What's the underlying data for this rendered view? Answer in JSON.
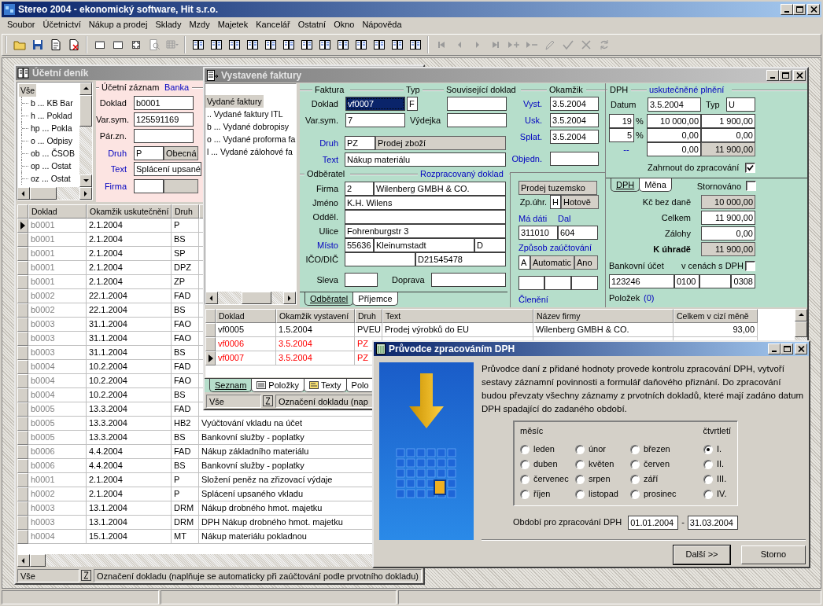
{
  "app": {
    "title": "Stereo 2004 - ekonomický software, Hit s.r.o."
  },
  "menu": [
    "Soubor",
    "Účetnictví",
    "Nákup a prodej",
    "Sklady",
    "Mzdy",
    "Majetek",
    "Kancelář",
    "Ostatní",
    "Okno",
    "Nápověda"
  ],
  "toolbar": [
    [
      {
        "kind": "folder",
        "disabled": false
      },
      {
        "kind": "save",
        "disabled": false
      },
      {
        "kind": "properties",
        "disabled": false
      },
      {
        "kind": "export",
        "disabled": false
      }
    ],
    [
      {
        "kind": "window",
        "disabled": false
      },
      {
        "kind": "window",
        "disabled": false
      },
      {
        "kind": "fit",
        "disabled": false
      },
      {
        "kind": "preview",
        "disabled": true
      },
      {
        "kind": "grid",
        "disabled": true
      }
    ],
    [
      {
        "kind": "book",
        "disabled": false
      },
      {
        "kind": "book",
        "disabled": false
      },
      {
        "kind": "book",
        "disabled": false
      },
      {
        "kind": "book",
        "disabled": false
      },
      {
        "kind": "book",
        "disabled": false
      },
      {
        "kind": "book",
        "disabled": false
      },
      {
        "kind": "book",
        "disabled": false
      },
      {
        "kind": "book",
        "disabled": false
      },
      {
        "kind": "book",
        "disabled": false
      },
      {
        "kind": "book",
        "disabled": false
      },
      {
        "kind": "book",
        "disabled": false
      },
      {
        "kind": "book",
        "disabled": false
      },
      {
        "kind": "book",
        "disabled": false
      }
    ],
    [
      {
        "kind": "first",
        "disabled": true
      },
      {
        "kind": "prev",
        "disabled": true
      },
      {
        "kind": "next",
        "disabled": true
      },
      {
        "kind": "last",
        "disabled": true
      },
      {
        "kind": "add",
        "disabled": true
      },
      {
        "kind": "remove",
        "disabled": true
      },
      {
        "kind": "pencil",
        "disabled": true
      },
      {
        "kind": "check",
        "disabled": true
      },
      {
        "kind": "cross",
        "disabled": true
      },
      {
        "kind": "refresh",
        "disabled": true
      }
    ]
  ],
  "journal": {
    "title": "Účetní deník",
    "tree": [
      {
        "label": "Vše",
        "selected": true,
        "children": [
          {
            "label": "b ... KB Bar",
            "selected": false
          },
          {
            "label": "h ... Poklad",
            "selected": false
          },
          {
            "label": "hp ... Pokla",
            "selected": false
          },
          {
            "label": "o ... Odpisy",
            "selected": false
          },
          {
            "label": "ob ... ČSOB",
            "selected": false
          },
          {
            "label": "op ... Ostat",
            "selected": false
          },
          {
            "label": "oz ... Ostat",
            "selected": false
          }
        ]
      }
    ],
    "record": {
      "legends": [
        {
          "text": "Účetní záznam",
          "link": false
        },
        {
          "text": "Banka",
          "link": true
        }
      ],
      "rows": [
        {
          "items": [
            {
              "kind": "label",
              "text": "Doklad",
              "link": false
            },
            {
              "kind": "box",
              "value": "b0001",
              "readonly": false
            }
          ]
        },
        {
          "items": [
            {
              "kind": "label",
              "text": "Var.sym.",
              "link": false
            },
            {
              "kind": "box",
              "value": "125591169",
              "readonly": false
            }
          ]
        },
        {
          "items": [
            {
              "kind": "label",
              "text": "Pár.zn.",
              "link": false
            },
            {
              "kind": "box",
              "readonly": false
            }
          ]
        },
        {
          "items": [
            {
              "kind": "label",
              "text": "Druh",
              "link": true
            },
            {
              "kind": "box",
              "value": "P",
              "readonly": false
            },
            {
              "kind": "box",
              "value": "Obecná",
              "readonly": true
            }
          ]
        },
        {
          "items": [
            {
              "kind": "label",
              "text": "Text",
              "link": true
            },
            {
              "kind": "box",
              "value": "Splácení upsané",
              "readonly": false
            }
          ]
        },
        {
          "items": [
            {
              "kind": "label",
              "text": "Firma",
              "link": true
            },
            {
              "kind": "box",
              "readonly": false
            },
            {
              "kind": "box",
              "readonly": true
            }
          ]
        }
      ]
    },
    "columns": [
      "Doklad",
      "Okamžik uskutečnění",
      "Druh"
    ],
    "rows": [
      {
        "doklad": "b0001",
        "date": "2.1.2004",
        "druh": "P",
        "selected": true
      },
      {
        "doklad": "b0001",
        "date": "2.1.2004",
        "druh": "BS",
        "selected": false
      },
      {
        "doklad": "b0001",
        "date": "2.1.2004",
        "druh": "SP",
        "selected": false
      },
      {
        "doklad": "b0001",
        "date": "2.1.2004",
        "druh": "DPZ",
        "selected": false
      },
      {
        "doklad": "b0001",
        "date": "2.1.2004",
        "druh": "ZP",
        "selected": false
      },
      {
        "doklad": "b0002",
        "date": "22.1.2004",
        "druh": "FAD",
        "selected": false
      },
      {
        "doklad": "b0002",
        "date": "22.1.2004",
        "druh": "BS",
        "selected": false
      },
      {
        "doklad": "b0003",
        "date": "31.1.2004",
        "druh": "FAO",
        "selected": false
      },
      {
        "doklad": "b0003",
        "date": "31.1.2004",
        "druh": "FAO",
        "selected": false
      },
      {
        "doklad": "b0003",
        "date": "31.1.2004",
        "druh": "BS",
        "selected": false
      },
      {
        "doklad": "b0004",
        "date": "10.2.2004",
        "druh": "FAD",
        "selected": false
      },
      {
        "doklad": "b0004",
        "date": "10.2.2004",
        "druh": "FAO",
        "selected": false
      },
      {
        "doklad": "b0004",
        "date": "10.2.2004",
        "druh": "BS",
        "selected": false
      },
      {
        "doklad": "b0005",
        "date": "13.3.2004",
        "druh": "FAD",
        "selected": false
      },
      {
        "doklad": "b0005",
        "date": "13.3.2004",
        "druh": "HB2",
        "text": "Vyúčtování vkladu na účet",
        "selected": false
      },
      {
        "doklad": "b0005",
        "date": "13.3.2004",
        "druh": "BS",
        "text": "Bankovní služby - poplatky",
        "selected": false
      },
      {
        "doklad": "b0006",
        "date": "4.4.2004",
        "druh": "FAD",
        "text": "Nákup základního materiálu",
        "selected": false
      },
      {
        "doklad": "b0006",
        "date": "4.4.2004",
        "druh": "BS",
        "text": "Bankovní služby - poplatky",
        "selected": false
      },
      {
        "doklad": "h0001",
        "date": "2.1.2004",
        "druh": "P",
        "text": "Složení peněz na zřizovací výdaje",
        "selected": false
      },
      {
        "doklad": "h0002",
        "date": "2.1.2004",
        "druh": "P",
        "text": "Splácení upsaného vkladu",
        "selected": false
      },
      {
        "doklad": "h0003",
        "date": "13.1.2004",
        "druh": "DRM",
        "text": "Nákup drobného hmot. majetku",
        "selected": false
      },
      {
        "doklad": "h0003",
        "date": "13.1.2004",
        "druh": "DRM",
        "text": "DPH Nákup drobného hmot. majetku",
        "selected": false
      },
      {
        "doklad": "h0004",
        "date": "15.1.2004",
        "druh": "MT",
        "text": "Nákup materiálu pokladnou",
        "selected": false
      }
    ],
    "status": {
      "filter": "Vše",
      "hint": "Označení dokladu (naplňuje se automaticky při zaúčtování podle prvotního dokladu)"
    }
  },
  "invoices": {
    "title": "Vystavené faktury",
    "tree": [
      {
        "label": "Vydané faktury",
        "selected": true
      },
      {
        "label": ".. Vydané faktury ITL",
        "selected": false
      },
      {
        "label": "b ... Vydané dobropisy",
        "selected": false
      },
      {
        "label": "o ... Vydané proforma fa",
        "selected": false
      },
      {
        "label": "l ... Vydané zálohové fa",
        "selected": false
      }
    ],
    "form": {
      "head_legends": [
        {
          "text": "Faktura",
          "link": false
        },
        {
          "text": "Typ",
          "link": false
        },
        {
          "text": "Související doklad",
          "link": false
        },
        {
          "text": "Okamžik",
          "link": false
        }
      ],
      "invoice_rows": [
        {
          "items": [
            {
              "kind": "label",
              "text": "Doklad",
              "link": false
            },
            {
              "kind": "box",
              "value": "vf0007",
              "readonly": false,
              "highlighted": true
            },
            {
              "kind": "box",
              "value": "F",
              "readonly": false,
              "highlighted": false
            },
            {
              "kind": "box",
              "readonly": false,
              "highlighted": false
            }
          ]
        },
        {
          "items": [
            {
              "kind": "label",
              "text": "Var.sym.",
              "link": false
            },
            {
              "kind": "box",
              "value": "7",
              "readonly": false,
              "highlighted": false
            },
            {
              "kind": "label",
              "text": "Výdejka",
              "link": false
            },
            {
              "kind": "box",
              "readonly": false,
              "highlighted": false
            }
          ]
        },
        {
          "items": [
            {
              "kind": "label",
              "text": "Druh",
              "link": true
            },
            {
              "kind": "box",
              "value": "PZ",
              "readonly": false,
              "highlighted": false
            },
            {
              "kind": "box",
              "value": "Prodej zboží",
              "readonly": true,
              "highlighted": false
            }
          ]
        },
        {
          "items": [
            {
              "kind": "label",
              "text": "Text",
              "link": true
            },
            {
              "kind": "box",
              "value": "Nákup materiálu",
              "readonly": false,
              "highlighted": false
            }
          ]
        }
      ],
      "date_rows": [
        {
          "items": [
            {
              "kind": "label",
              "text": "Vyst.",
              "link": true
            },
            {
              "kind": "box",
              "value": "3.5.2004",
              "readonly": false
            }
          ]
        },
        {
          "items": [
            {
              "kind": "label",
              "text": "Usk.",
              "link": true
            },
            {
              "kind": "box",
              "value": "3.5.2004",
              "readonly": false
            }
          ]
        },
        {
          "items": [
            {
              "kind": "label",
              "text": "Splat.",
              "link": true
            },
            {
              "kind": "box",
              "value": "3.5.2004",
              "readonly": false
            }
          ]
        },
        {
          "items": [
            {
              "kind": "label",
              "text": "Objedn.",
              "link": true
            },
            {
              "kind": "box",
              "readonly": false
            }
          ]
        }
      ],
      "customer_legends": [
        {
          "text": "Odběratel",
          "link": false
        },
        {
          "text": "Rozpracovaný doklad",
          "link": true
        }
      ],
      "customer_rows": [
        {
          "items": [
            {
              "kind": "label",
              "text": "Firma",
              "link": false
            },
            {
              "kind": "box",
              "value": "2",
              "readonly": false
            },
            {
              "kind": "box",
              "value": "Wilenberg GMBH & CO.",
              "readonly": false
            }
          ]
        },
        {
          "items": [
            {
              "kind": "label",
              "text": "Jméno",
              "link": false
            },
            {
              "kind": "box",
              "value": "K.H. Wilens",
              "readonly": false
            }
          ]
        },
        {
          "items": [
            {
              "kind": "label",
              "text": "Odděl.",
              "link": false
            },
            {
              "kind": "box",
              "readonly": false
            }
          ]
        },
        {
          "items": [
            {
              "kind": "label",
              "text": "Ulice",
              "link": false
            },
            {
              "kind": "box",
              "value": "Fohrenburgstr 3",
              "readonly": false
            }
          ]
        },
        {
          "items": [
            {
              "kind": "label",
              "text": "Místo",
              "link": true
            },
            {
              "kind": "box",
              "value": "55636",
              "readonly": false
            },
            {
              "kind": "box",
              "value": "Kleinumstadt",
              "readonly": false
            },
            {
              "kind": "box",
              "value": "D",
              "readonly": false
            }
          ]
        },
        {
          "items": [
            {
              "kind": "label",
              "text": "IČO/DIČ",
              "link": false
            },
            {
              "kind": "box",
              "readonly": false
            },
            {
              "kind": "box",
              "value": "D21545478",
              "readonly": false
            }
          ]
        },
        {
          "items": [
            {
              "kind": "label",
              "text": "Sleva",
              "link": false
            },
            {
              "kind": "box",
              "readonly": false
            },
            {
              "kind": "label",
              "text": "Doprava",
              "link": false
            },
            {
              "kind": "box",
              "readonly": false
            }
          ]
        }
      ],
      "customer_tabs": [
        {
          "label": "Odběratel",
          "selected": true
        },
        {
          "label": "Příjemce",
          "selected": false
        }
      ],
      "posting_rows": [
        {
          "items": [
            {
              "kind": "box",
              "value": "Prodej tuzemsko",
              "readonly": true
            }
          ]
        },
        {
          "items": [
            {
              "kind": "label",
              "text": "Zp.úhr.",
              "link": false
            },
            {
              "kind": "box",
              "value": "H",
              "readonly": false
            },
            {
              "kind": "box",
              "value": "Hotově",
              "readonly": true
            }
          ]
        },
        {
          "items": [
            {
              "kind": "label",
              "text": "Má dáti",
              "link": true
            },
            {
              "kind": "label",
              "text": "Dal",
              "link": true
            }
          ]
        },
        {
          "items": [
            {
              "kind": "box",
              "value": "311010",
              "readonly": false
            },
            {
              "kind": "box",
              "value": "604",
              "readonly": false
            }
          ]
        },
        {
          "items": [
            {
              "kind": "label",
              "text": "Způsob zaúčtování",
              "link": true
            }
          ]
        },
        {
          "items": [
            {
              "kind": "box",
              "value": "A",
              "readonly": false
            },
            {
              "kind": "box",
              "value": "Automatic",
              "readonly": true
            },
            {
              "kind": "box",
              "value": "Ano",
              "readonly": true
            }
          ]
        },
        {
          "items": [
            {
              "kind": "box",
              "readonly": false
            },
            {
              "kind": "box",
              "readonly": false
            },
            {
              "kind": "box",
              "readonly": false
            }
          ]
        },
        {
          "items": [
            {
              "kind": "label",
              "text": "Členění",
              "link": true
            }
          ]
        }
      ],
      "vat_legends": [
        {
          "text": "DPH",
          "link": false
        },
        {
          "text": "uskutečněné plnění",
          "link": true
        }
      ],
      "vat_rows": [
        {
          "items": [
            {
              "kind": "label",
              "text": "Datum",
              "link": false
            },
            {
              "kind": "box",
              "value": "3.5.2004",
              "readonly": false
            },
            {
              "kind": "label",
              "text": "Typ",
              "link": false
            },
            {
              "kind": "box",
              "value": "U",
              "readonly": false
            }
          ]
        },
        {
          "items": [
            {
              "kind": "num",
              "value": "19",
              "readonly": false
            },
            {
              "kind": "label",
              "text": "%",
              "link": false
            },
            {
              "kind": "num",
              "value": "10 000,00",
              "readonly": false
            },
            {
              "kind": "num",
              "value": "1 900,00",
              "readonly": false
            }
          ]
        },
        {
          "items": [
            {
              "kind": "num",
              "value": "5",
              "readonly": false
            },
            {
              "kind": "label",
              "text": "%",
              "link": false
            },
            {
              "kind": "num",
              "value": "0,00",
              "readonly": false
            },
            {
              "kind": "num",
              "value": "0,00",
              "readonly": false
            }
          ]
        },
        {
          "items": [
            {
              "kind": "label",
              "text": "--",
              "link": true
            },
            {
              "kind": "num",
              "value": "0,00",
              "readonly": false
            },
            {
              "kind": "num",
              "value": "11 900,00",
              "readonly": true
            }
          ]
        },
        {
          "items": [
            {
              "kind": "label",
              "text": "Zahrnout do zpracování",
              "link": false
            },
            {
              "kind": "check",
              "checked": true
            }
          ]
        }
      ],
      "vat_tabs": [
        {
          "label": "DPH",
          "selected": true
        },
        {
          "label": "Měna",
          "selected": false
        }
      ],
      "cancelled": {
        "label": "Stornováno",
        "checked": false
      },
      "total_rows": [
        {
          "items": [
            {
              "kind": "label",
              "text": "Kč bez daně",
              "link": false
            },
            {
              "kind": "num",
              "value": "10 000,00",
              "readonly": true
            }
          ]
        },
        {
          "items": [
            {
              "kind": "label",
              "text": "Celkem",
              "link": false
            },
            {
              "kind": "num",
              "value": "11 900,00",
              "readonly": false
            }
          ]
        },
        {
          "items": [
            {
              "kind": "label",
              "text": "Zálohy",
              "link": false
            },
            {
              "kind": "num",
              "value": "0,00",
              "readonly": false
            }
          ]
        },
        {
          "items": [
            {
              "kind": "strong",
              "text": "K úhradě",
              "link": false
            },
            {
              "kind": "num",
              "value": "11 900,00",
              "readonly": true
            }
          ]
        },
        {
          "items": [
            {
              "kind": "label",
              "text": "Bankovní účet",
              "link": false
            },
            {
              "kind": "label",
              "text": "v cenách s DPH",
              "link": false
            },
            {
              "kind": "check",
              "checked": false
            }
          ]
        },
        {
          "items": [
            {
              "kind": "box",
              "value": "123246",
              "readonly": false
            },
            {
              "kind": "box",
              "value": "0100",
              "readonly": false
            },
            {
              "kind": "box",
              "readonly": false
            },
            {
              "kind": "num",
              "value": "0308",
              "readonly": false
            }
          ]
        },
        {
          "items": [
            {
              "kind": "label",
              "text": "Položek",
              "link": false
            },
            {
              "kind": "label",
              "text": "(0)",
              "link": true
            }
          ]
        }
      ]
    },
    "columns": [
      "Doklad",
      "Okamžik vystavení",
      "Druh",
      "Text",
      "Název firmy",
      "Celkem v cizí měně"
    ],
    "rows": [
      {
        "cells": [
          "vf0005",
          "1.5.2004",
          "PVEU",
          "Prodej výrobků do EU",
          "Wilenberg GMBH & CO.",
          "93,00"
        ],
        "flagged": false,
        "selected": false
      },
      {
        "cells": [
          "vf0006",
          "3.5.2004",
          "PZ"
        ],
        "flagged": true,
        "selected": false
      },
      {
        "cells": [
          "vf0007",
          "3.5.2004",
          "PZ"
        ],
        "flagged": true,
        "selected": true
      }
    ],
    "tabs": [
      {
        "label": "Seznam",
        "selected": true,
        "kind": "plain"
      },
      {
        "label": "Položky",
        "selected": false,
        "kind": "list"
      },
      {
        "label": "Texty",
        "selected": false,
        "kind": "note"
      },
      {
        "label": "Polo",
        "selected": false,
        "kind": "plain"
      }
    ],
    "status": {
      "filter": "Vše",
      "hint": "Označení dokladu (nap"
    }
  },
  "dialog": {
    "title": "Průvodce zpracováním DPH",
    "intro": "Průvodce daní z přidané hodnoty provede kontrolu zpracování DPH, vytvoří sestavy záznamní povinnosti a formulář daňového přiznání. Do zpracování budou převzaty všechny záznamy z prvotních dokladů, které mají zadáno datum DPH spadající do zadaného období.",
    "month_header": "měsíc",
    "quarter_header": "čtvrtletí",
    "months": [
      {
        "label": "leden",
        "selected": false
      },
      {
        "label": "únor",
        "selected": false
      },
      {
        "label": "březen",
        "selected": false
      },
      {
        "label": "duben",
        "selected": false
      },
      {
        "label": "květen",
        "selected": false
      },
      {
        "label": "červen",
        "selected": false
      },
      {
        "label": "červenec",
        "selected": false
      },
      {
        "label": "srpen",
        "selected": false
      },
      {
        "label": "září",
        "selected": false
      },
      {
        "label": "říjen",
        "selected": false
      },
      {
        "label": "listopad",
        "selected": false
      },
      {
        "label": "prosinec",
        "selected": false
      }
    ],
    "quarters": [
      {
        "label": "I.",
        "selected": true
      },
      {
        "label": "II.",
        "selected": false
      },
      {
        "label": "III.",
        "selected": false
      },
      {
        "label": "IV.",
        "selected": false
      }
    ],
    "period_label": "Období pro zpracování DPH",
    "from": "01.01.2004",
    "separator": "-",
    "to": "31.03.2004",
    "buttons": [
      {
        "label": "Další >>",
        "default": true
      },
      {
        "label": "Storno",
        "default": false
      }
    ]
  }
}
